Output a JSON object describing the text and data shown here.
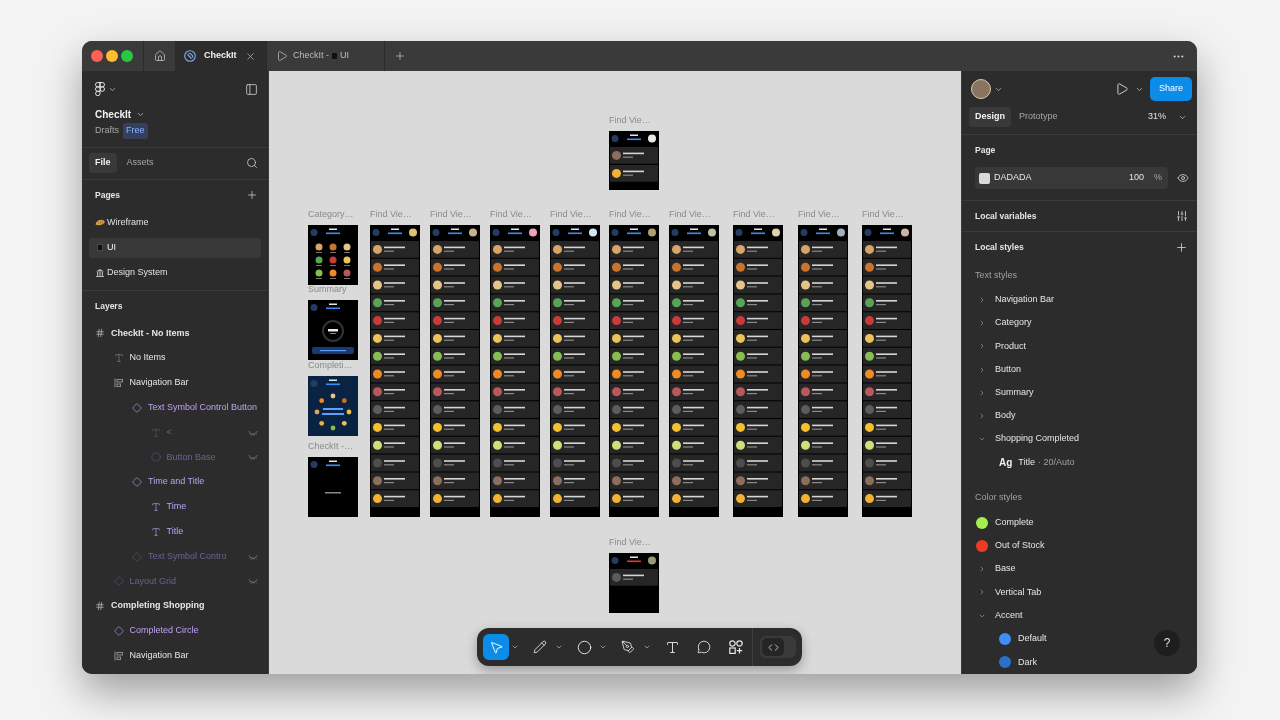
{
  "titlebar": {
    "tabs": [
      {
        "kind": "home",
        "selected": false
      },
      {
        "kind": "file",
        "label": "CheckIt",
        "selected": true
      },
      {
        "kind": "prototype",
        "label": "CheckIt -",
        "page": "UI",
        "selected": false
      }
    ]
  },
  "sidebar": {
    "file_name": "CheckIt",
    "location": "Drafts",
    "plan": "Free",
    "tabs": [
      {
        "label": "File",
        "selected": true
      },
      {
        "label": "Assets",
        "selected": false
      }
    ],
    "pages_title": "Pages",
    "pages": [
      {
        "name": "Wireframe",
        "kind": "bread",
        "selected": false
      },
      {
        "name": "UI",
        "kind": "screen",
        "selected": true
      },
      {
        "name": "Design System",
        "kind": "bank",
        "selected": false
      }
    ],
    "layers_title": "Layers",
    "layers": [
      {
        "name": "CheckIt - No Items",
        "kind": "frame",
        "hidden": false,
        "children": [
          {
            "name": "No Items",
            "kind": "text",
            "hidden": false
          },
          {
            "name": "Navigation Bar",
            "kind": "autolayout",
            "hidden": false,
            "children": [
              {
                "name": "Text Symbol Control Button",
                "kind": "instance",
                "hidden": false,
                "children": [
                  {
                    "name": "<",
                    "kind": "text",
                    "hidden": true
                  },
                  {
                    "name": "Button Base",
                    "kind": "ellipse",
                    "hidden": true
                  }
                ]
              },
              {
                "name": "Time and Title",
                "kind": "instance",
                "hidden": false,
                "children": [
                  {
                    "name": "Time",
                    "kind": "text",
                    "hidden": false
                  },
                  {
                    "name": "Title",
                    "kind": "text",
                    "hidden": false
                  }
                ]
              },
              {
                "name": "Text Symbol Contro",
                "kind": "instance",
                "hidden": true
              }
            ]
          },
          {
            "name": "Layout Grid",
            "kind": "instance",
            "hidden": true
          }
        ]
      },
      {
        "name": "Completing Shopping",
        "kind": "frame",
        "hidden": false,
        "children": [
          {
            "name": "Completed Circle",
            "kind": "instance",
            "hidden": false
          },
          {
            "name": "Navigation Bar",
            "kind": "autolayout",
            "hidden": false
          }
        ]
      }
    ]
  },
  "canvas": {
    "frames": [
      {
        "label": "Find Vie…",
        "kind": "short_list"
      },
      {
        "label": "Category…",
        "kind": "category"
      },
      {
        "label": "Summary",
        "kind": "summary"
      },
      {
        "label": "Completi…",
        "kind": "completed"
      },
      {
        "label": "CheckIt -…",
        "kind": "empty"
      },
      {
        "label": "Find Vie…",
        "kind": "list"
      },
      {
        "label": "Find Vie…",
        "kind": "list"
      },
      {
        "label": "Find Vie…",
        "kind": "list"
      },
      {
        "label": "Find Vie…",
        "kind": "list"
      },
      {
        "label": "Find Vie…",
        "kind": "list"
      },
      {
        "label": "Find Vie…",
        "kind": "list"
      },
      {
        "label": "Find Vie…",
        "kind": "list"
      },
      {
        "label": "Find Vie…",
        "kind": "list"
      },
      {
        "label": "Find Vie…",
        "kind": "list"
      },
      {
        "label": "Find Vie…",
        "kind": "out_of_stock"
      }
    ]
  },
  "toolbar": {
    "tools": [
      {
        "kind": "move",
        "selected": true,
        "menu": true
      },
      {
        "kind": "pencil",
        "selected": false,
        "menu": true
      },
      {
        "kind": "ellipse",
        "selected": false,
        "menu": true
      },
      {
        "kind": "pen",
        "selected": false,
        "menu": true
      },
      {
        "kind": "text",
        "selected": false,
        "menu": false
      },
      {
        "kind": "comment",
        "selected": false,
        "menu": false
      },
      {
        "kind": "actions",
        "selected": false,
        "menu": false
      }
    ],
    "dev_mode": {
      "on": false
    }
  },
  "inspector": {
    "tabs": [
      {
        "label": "Design",
        "selected": true
      },
      {
        "label": "Prototype",
        "selected": false
      }
    ],
    "zoom": "31%",
    "share": "Share",
    "page": {
      "title": "Page",
      "color": "#dadada",
      "hex": "DADADA",
      "opacity": "100",
      "unit": "%"
    },
    "variables_title": "Local variables",
    "styles_title": "Local styles",
    "text_styles_title": "Text styles",
    "text_styles": [
      {
        "name": "Navigation Bar",
        "expanded": false
      },
      {
        "name": "Category",
        "expanded": false
      },
      {
        "name": "Product",
        "expanded": false
      },
      {
        "name": "Button",
        "expanded": false
      },
      {
        "name": "Summary",
        "expanded": false
      },
      {
        "name": "Body",
        "expanded": false
      },
      {
        "name": "Shopping Completed",
        "expanded": true,
        "children": [
          {
            "sample": "Ag",
            "name": "Title",
            "detail": "· 20/Auto"
          }
        ]
      }
    ],
    "color_styles_title": "Color styles",
    "color_styles": [
      {
        "kind": "color",
        "name": "Complete",
        "color": "#a3ef4c"
      },
      {
        "kind": "color",
        "name": "Out of Stock",
        "color": "#ee3b24"
      },
      {
        "kind": "group",
        "name": "Base",
        "expanded": false
      },
      {
        "kind": "group",
        "name": "Vertical Tab",
        "expanded": false
      },
      {
        "kind": "group",
        "name": "Accent",
        "expanded": true,
        "children": [
          {
            "kind": "color",
            "name": "Default",
            "color": "#3e8ef6"
          },
          {
            "kind": "color",
            "name": "Dark",
            "color": "#2e6fca"
          }
        ]
      }
    ],
    "help": "?"
  }
}
